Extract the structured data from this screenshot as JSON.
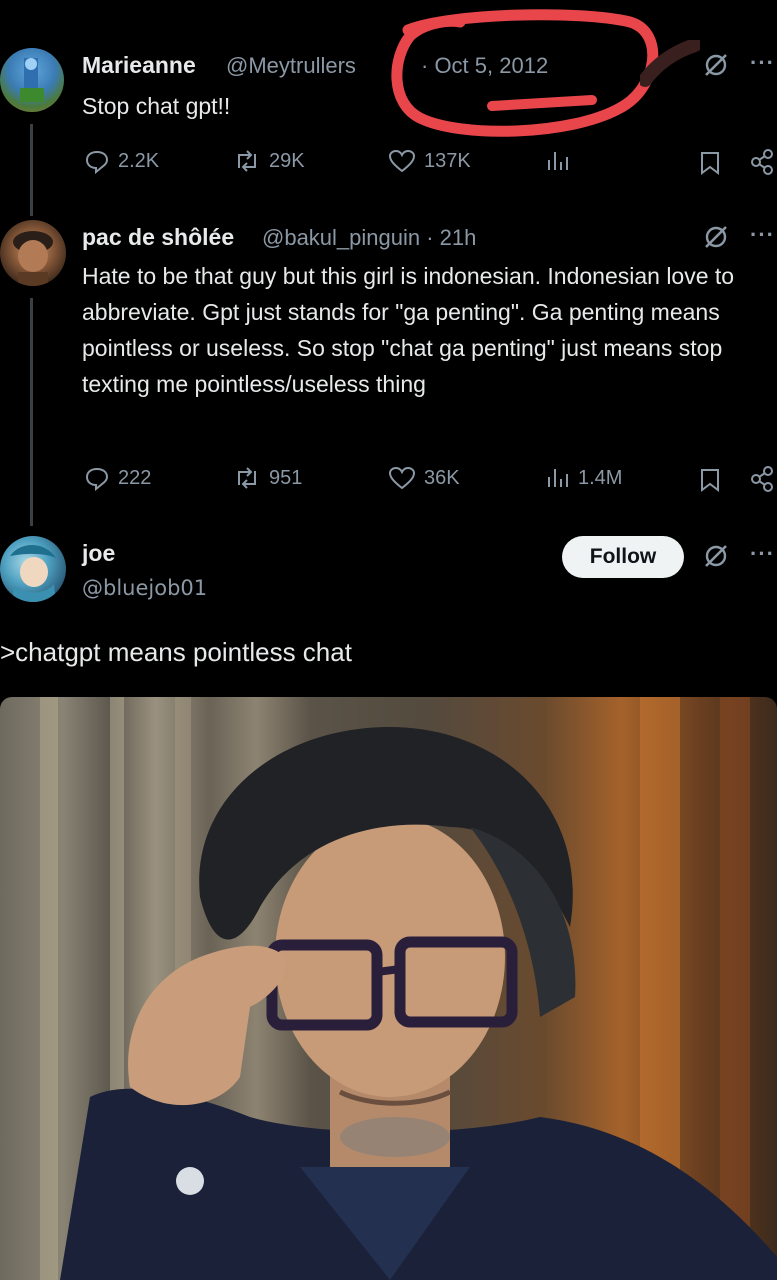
{
  "tweets": [
    {
      "display_name": "Marieanne",
      "handle": "@Meytrullers",
      "date": "· Oct 5, 2012",
      "text": "Stop chat gpt!!",
      "stats": {
        "replies": "2.2K",
        "reposts": "29K",
        "likes": "137K",
        "views": ""
      }
    },
    {
      "display_name": "pac de shôlée",
      "handle": "@bakul_pinguin · 21h",
      "text": "Hate to be that guy but this girl is indonesian. Indonesian love to abbreviate. Gpt just stands for \"ga penting\". Ga penting means pointless or useless. So stop \"chat ga penting\" just means stop texting me pointless/useless thing",
      "stats": {
        "replies": "222",
        "reposts": "951",
        "likes": "36K",
        "views": "1.4M"
      }
    },
    {
      "display_name": "joe",
      "handle": "@bluejob01",
      "follow_label": "Follow",
      "text": ">chatgpt means pointless chat"
    }
  ],
  "colors": {
    "background": "#000000",
    "text": "#e7e9ea",
    "muted": "#8b98a5",
    "annotation": "#e8464a"
  },
  "icons": [
    "reply-icon",
    "repost-icon",
    "like-icon",
    "views-icon",
    "bookmark-icon",
    "share-icon",
    "grok-icon",
    "more-icon"
  ]
}
